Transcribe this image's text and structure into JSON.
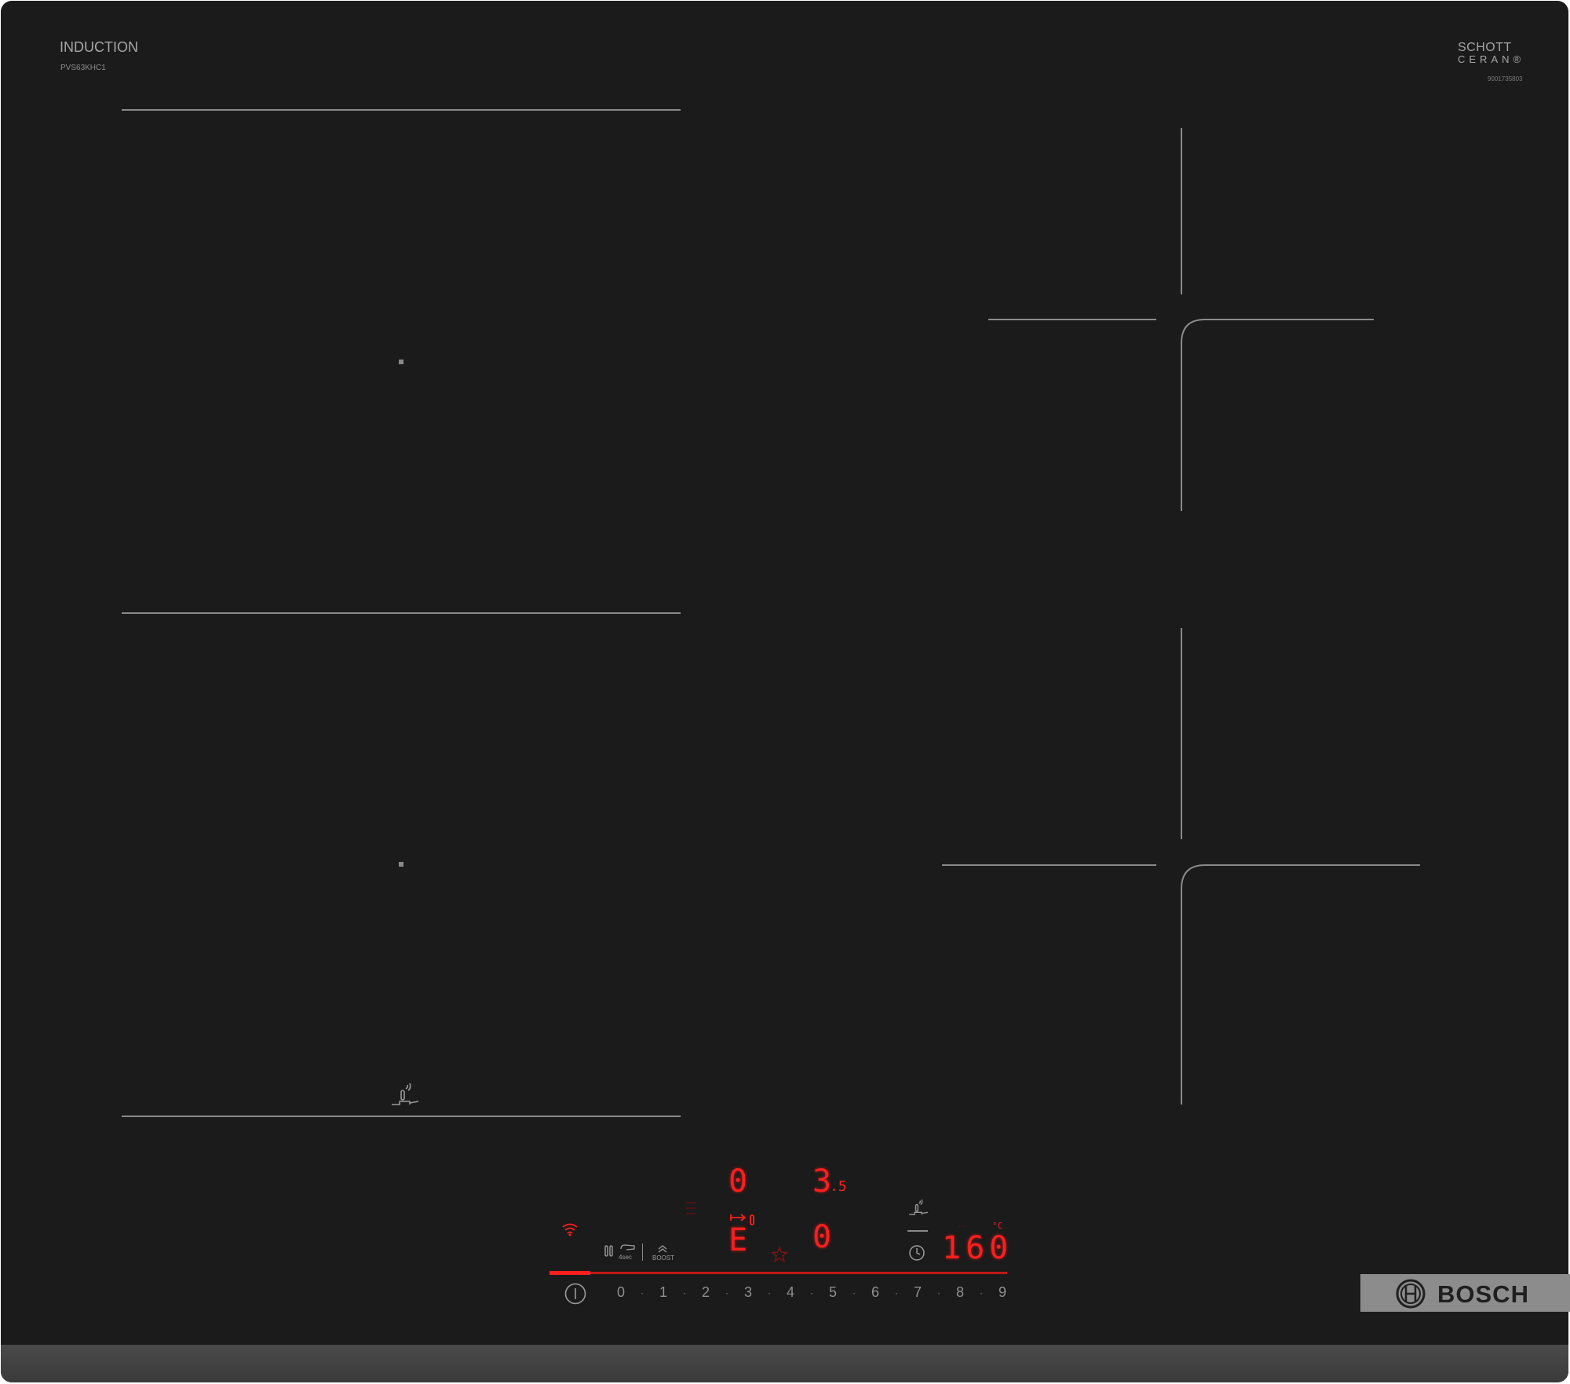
{
  "header": {
    "brand_label": "INDUCTION",
    "model_code": "PVS63KHC1",
    "glass_brand_line1": "SCHOTT",
    "glass_brand_line2": "CERAN®",
    "part_number": "9001735803"
  },
  "display": {
    "zone_level_top_left": "0",
    "zone_level_top_right_main": "3",
    "zone_level_top_right_fraction": ".5",
    "zone_level_bottom_left": "E",
    "zone_level_bottom_right": "0",
    "temperature_value": "160",
    "temperature_unit": "°C"
  },
  "controls": {
    "timer_label": "4sec",
    "boost_label": "BOOST"
  },
  "slider": {
    "numbers": [
      "0",
      "1",
      "2",
      "3",
      "4",
      "5",
      "6",
      "7",
      "8",
      "9"
    ],
    "separator": "·"
  },
  "logo": {
    "text": "BOSCH"
  },
  "colors": {
    "glass": "#1b1b1b",
    "zone_marks": "#8a8a8a",
    "display_red": "#ff1e1e",
    "logo_plate": "#8c8c8c"
  },
  "icons": [
    "wifi-icon",
    "power-icon",
    "pan-sensor-icon",
    "clock-icon",
    "star-icon",
    "boost-icon",
    "wipe-protect-icon",
    "thermometer-icon"
  ]
}
